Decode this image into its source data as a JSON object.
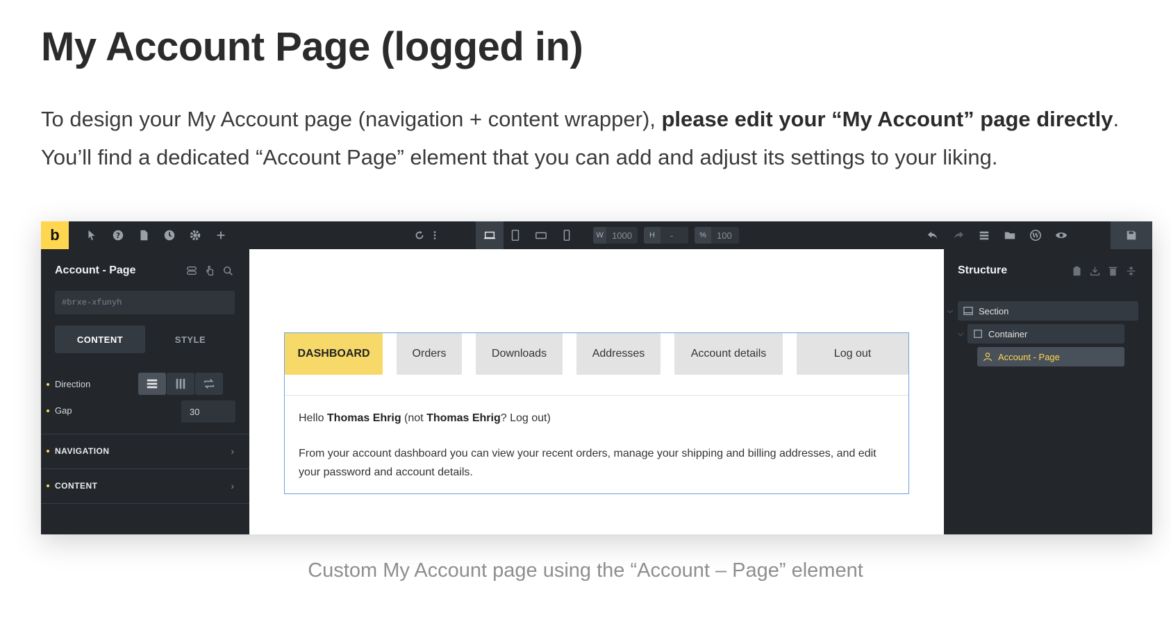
{
  "article": {
    "title": "My Account Page (logged in)",
    "intro_pre": "To design your My Account page (navigation + content wrapper), ",
    "intro_bold": "please edit your “My Account” page directly",
    "intro_post": ". You’ll find a dedicated “Account Page” element that you can add and adjust its settings to your liking.",
    "caption": "Custom My Account page using the “Account – Page” element"
  },
  "toolbar": {
    "logo": "b",
    "width_key": "W",
    "width_value": "1000",
    "height_key": "H",
    "height_value": "-",
    "zoom_key": "%",
    "zoom_value": "100"
  },
  "left_panel": {
    "title": "Account - Page",
    "element_id": "#brxe-xfunyh",
    "tab_content": "CONTENT",
    "tab_style": "STYLE",
    "direction_label": "Direction",
    "gap_label": "Gap",
    "gap_value": "30",
    "section_navigation": "NAVIGATION",
    "section_content": "CONTENT"
  },
  "canvas": {
    "nav": [
      "DASHBOARD",
      "Orders",
      "Downloads",
      "Addresses",
      "Account details",
      "Log out"
    ],
    "hello_pre": "Hello ",
    "user_name": "Thomas Ehrig",
    "hello_mid": " (not ",
    "user_name2": "Thomas Ehrig",
    "hello_post": "? Log out)",
    "description": "From your account dashboard you can view your recent orders, manage your shipping and billing addresses, and edit your password and account details."
  },
  "right_panel": {
    "title": "Structure",
    "tree": [
      "Section",
      "Container",
      "Account - Page"
    ]
  },
  "colors": {
    "accent": "#ffd64f",
    "panel_bg": "#23272c",
    "nav_active": "#f7d969",
    "nav_inactive": "#e3e3e3",
    "outline": "#6aa3e0"
  }
}
